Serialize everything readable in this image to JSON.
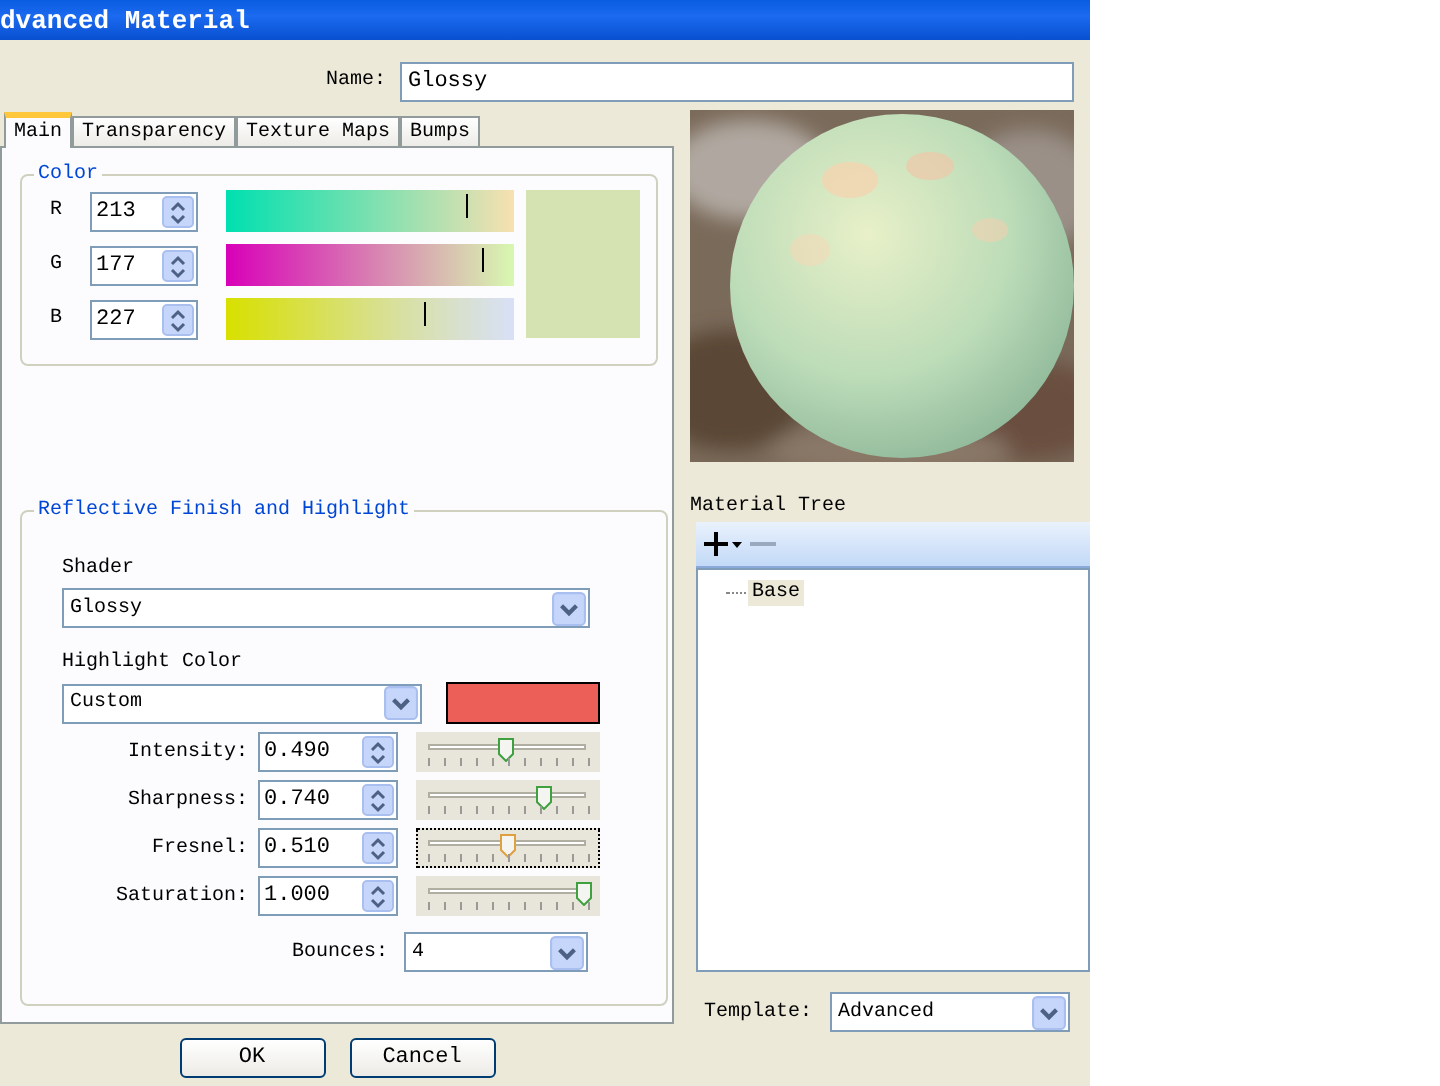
{
  "window": {
    "title": "dvanced Material"
  },
  "name": {
    "label": "Name:",
    "value": "Glossy"
  },
  "tabs": [
    {
      "label": "Main",
      "selected": true
    },
    {
      "label": "Transparency",
      "selected": false
    },
    {
      "label": "Texture Maps",
      "selected": false
    },
    {
      "label": "Bumps",
      "selected": false
    }
  ],
  "color_group": {
    "title": "Color",
    "channels": [
      {
        "label": "R",
        "value": "213",
        "level": 0.83
      },
      {
        "label": "G",
        "value": "177",
        "level": 0.89
      },
      {
        "label": "B",
        "value": "227",
        "level": 0.69
      }
    ]
  },
  "reflective": {
    "title": "Reflective Finish and Highlight",
    "shader": {
      "label": "Shader",
      "value": "Glossy"
    },
    "highlight_color": {
      "label": "Highlight Color",
      "value": "Custom"
    },
    "params": [
      {
        "label": "Intensity:",
        "value": "0.490",
        "level": 0.49,
        "focused": false
      },
      {
        "label": "Sharpness:",
        "value": "0.740",
        "level": 0.74,
        "focused": false
      },
      {
        "label": "Fresnel:",
        "value": "0.510",
        "level": 0.51,
        "focused": true
      },
      {
        "label": "Saturation:",
        "value": "1.000",
        "level": 1.0,
        "focused": false
      }
    ],
    "bounces": {
      "label": "Bounces:",
      "value": "4"
    }
  },
  "buttons": [
    "OK",
    "Cancel"
  ],
  "material_tree": {
    "title": "Material Tree",
    "items": [
      {
        "label": "Base",
        "selected": true
      }
    ]
  },
  "template": {
    "label": "Template:",
    "value": "Advanced"
  }
}
